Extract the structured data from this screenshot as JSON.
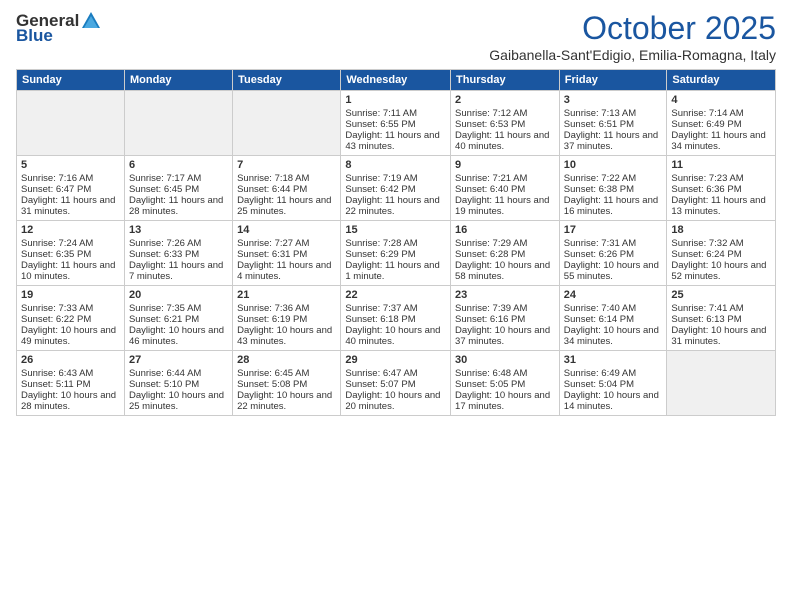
{
  "header": {
    "logo_general": "General",
    "logo_blue": "Blue",
    "title": "October 2025",
    "subtitle": "Gaibanella-Sant'Edigio, Emilia-Romagna, Italy"
  },
  "days_of_week": [
    "Sunday",
    "Monday",
    "Tuesday",
    "Wednesday",
    "Thursday",
    "Friday",
    "Saturday"
  ],
  "weeks": [
    [
      {
        "day": "",
        "empty": true
      },
      {
        "day": "",
        "empty": true
      },
      {
        "day": "",
        "empty": true
      },
      {
        "day": "1",
        "sunrise": "Sunrise: 7:11 AM",
        "sunset": "Sunset: 6:55 PM",
        "daylight": "Daylight: 11 hours and 43 minutes."
      },
      {
        "day": "2",
        "sunrise": "Sunrise: 7:12 AM",
        "sunset": "Sunset: 6:53 PM",
        "daylight": "Daylight: 11 hours and 40 minutes."
      },
      {
        "day": "3",
        "sunrise": "Sunrise: 7:13 AM",
        "sunset": "Sunset: 6:51 PM",
        "daylight": "Daylight: 11 hours and 37 minutes."
      },
      {
        "day": "4",
        "sunrise": "Sunrise: 7:14 AM",
        "sunset": "Sunset: 6:49 PM",
        "daylight": "Daylight: 11 hours and 34 minutes."
      }
    ],
    [
      {
        "day": "5",
        "sunrise": "Sunrise: 7:16 AM",
        "sunset": "Sunset: 6:47 PM",
        "daylight": "Daylight: 11 hours and 31 minutes."
      },
      {
        "day": "6",
        "sunrise": "Sunrise: 7:17 AM",
        "sunset": "Sunset: 6:45 PM",
        "daylight": "Daylight: 11 hours and 28 minutes."
      },
      {
        "day": "7",
        "sunrise": "Sunrise: 7:18 AM",
        "sunset": "Sunset: 6:44 PM",
        "daylight": "Daylight: 11 hours and 25 minutes."
      },
      {
        "day": "8",
        "sunrise": "Sunrise: 7:19 AM",
        "sunset": "Sunset: 6:42 PM",
        "daylight": "Daylight: 11 hours and 22 minutes."
      },
      {
        "day": "9",
        "sunrise": "Sunrise: 7:21 AM",
        "sunset": "Sunset: 6:40 PM",
        "daylight": "Daylight: 11 hours and 19 minutes."
      },
      {
        "day": "10",
        "sunrise": "Sunrise: 7:22 AM",
        "sunset": "Sunset: 6:38 PM",
        "daylight": "Daylight: 11 hours and 16 minutes."
      },
      {
        "day": "11",
        "sunrise": "Sunrise: 7:23 AM",
        "sunset": "Sunset: 6:36 PM",
        "daylight": "Daylight: 11 hours and 13 minutes."
      }
    ],
    [
      {
        "day": "12",
        "sunrise": "Sunrise: 7:24 AM",
        "sunset": "Sunset: 6:35 PM",
        "daylight": "Daylight: 11 hours and 10 minutes."
      },
      {
        "day": "13",
        "sunrise": "Sunrise: 7:26 AM",
        "sunset": "Sunset: 6:33 PM",
        "daylight": "Daylight: 11 hours and 7 minutes."
      },
      {
        "day": "14",
        "sunrise": "Sunrise: 7:27 AM",
        "sunset": "Sunset: 6:31 PM",
        "daylight": "Daylight: 11 hours and 4 minutes."
      },
      {
        "day": "15",
        "sunrise": "Sunrise: 7:28 AM",
        "sunset": "Sunset: 6:29 PM",
        "daylight": "Daylight: 11 hours and 1 minute."
      },
      {
        "day": "16",
        "sunrise": "Sunrise: 7:29 AM",
        "sunset": "Sunset: 6:28 PM",
        "daylight": "Daylight: 10 hours and 58 minutes."
      },
      {
        "day": "17",
        "sunrise": "Sunrise: 7:31 AM",
        "sunset": "Sunset: 6:26 PM",
        "daylight": "Daylight: 10 hours and 55 minutes."
      },
      {
        "day": "18",
        "sunrise": "Sunrise: 7:32 AM",
        "sunset": "Sunset: 6:24 PM",
        "daylight": "Daylight: 10 hours and 52 minutes."
      }
    ],
    [
      {
        "day": "19",
        "sunrise": "Sunrise: 7:33 AM",
        "sunset": "Sunset: 6:22 PM",
        "daylight": "Daylight: 10 hours and 49 minutes."
      },
      {
        "day": "20",
        "sunrise": "Sunrise: 7:35 AM",
        "sunset": "Sunset: 6:21 PM",
        "daylight": "Daylight: 10 hours and 46 minutes."
      },
      {
        "day": "21",
        "sunrise": "Sunrise: 7:36 AM",
        "sunset": "Sunset: 6:19 PM",
        "daylight": "Daylight: 10 hours and 43 minutes."
      },
      {
        "day": "22",
        "sunrise": "Sunrise: 7:37 AM",
        "sunset": "Sunset: 6:18 PM",
        "daylight": "Daylight: 10 hours and 40 minutes."
      },
      {
        "day": "23",
        "sunrise": "Sunrise: 7:39 AM",
        "sunset": "Sunset: 6:16 PM",
        "daylight": "Daylight: 10 hours and 37 minutes."
      },
      {
        "day": "24",
        "sunrise": "Sunrise: 7:40 AM",
        "sunset": "Sunset: 6:14 PM",
        "daylight": "Daylight: 10 hours and 34 minutes."
      },
      {
        "day": "25",
        "sunrise": "Sunrise: 7:41 AM",
        "sunset": "Sunset: 6:13 PM",
        "daylight": "Daylight: 10 hours and 31 minutes."
      }
    ],
    [
      {
        "day": "26",
        "sunrise": "Sunrise: 6:43 AM",
        "sunset": "Sunset: 5:11 PM",
        "daylight": "Daylight: 10 hours and 28 minutes."
      },
      {
        "day": "27",
        "sunrise": "Sunrise: 6:44 AM",
        "sunset": "Sunset: 5:10 PM",
        "daylight": "Daylight: 10 hours and 25 minutes."
      },
      {
        "day": "28",
        "sunrise": "Sunrise: 6:45 AM",
        "sunset": "Sunset: 5:08 PM",
        "daylight": "Daylight: 10 hours and 22 minutes."
      },
      {
        "day": "29",
        "sunrise": "Sunrise: 6:47 AM",
        "sunset": "Sunset: 5:07 PM",
        "daylight": "Daylight: 10 hours and 20 minutes."
      },
      {
        "day": "30",
        "sunrise": "Sunrise: 6:48 AM",
        "sunset": "Sunset: 5:05 PM",
        "daylight": "Daylight: 10 hours and 17 minutes."
      },
      {
        "day": "31",
        "sunrise": "Sunrise: 6:49 AM",
        "sunset": "Sunset: 5:04 PM",
        "daylight": "Daylight: 10 hours and 14 minutes."
      },
      {
        "day": "",
        "empty": true
      }
    ]
  ]
}
